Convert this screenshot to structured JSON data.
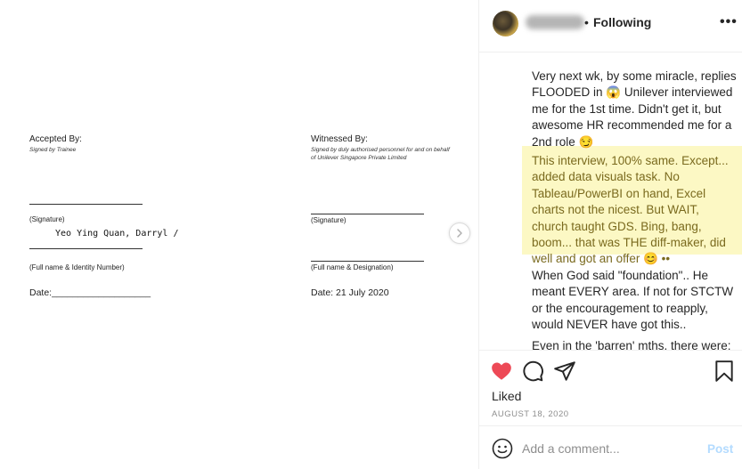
{
  "document": {
    "accepted_title": "Accepted By:",
    "accepted_sub": "Signed by Trainee",
    "witnessed_title": "Witnessed By:",
    "witnessed_sub": "Signed by duly authorised personnel for and on behalf of Unilever Singapore Private Limited",
    "signature_label": "(Signature)",
    "typed_name": "Yeo Ying Quan, Darryl /",
    "fullname_id_label": "(Full name & Identity Number)",
    "fullname_designation_label": "(Full name & Designation)",
    "date_left": "Date:___________________",
    "date_right": "Date: 21 July 2020"
  },
  "carousel": {
    "next_icon": "chevron-right-icon"
  },
  "header": {
    "separator": "•",
    "follow_label": "Following",
    "more_icon": "more-horizontal-icon",
    "more_label": "•••"
  },
  "caption": {
    "paragraphs": [
      "Very next wk, by some miracle, replies FLOODED in 😱 Unilever interviewed me for the 1st time. Didn't get it, but awesome HR recommended me for a 2nd role 😏",
      "This interview, 100% same. Except... added data visuals task. No Tableau/PowerBI on hand, Excel charts not the nicest. But WAIT, church taught GDS. Bing, bang, boom... that was THE diff-maker, did well and got an offer 😊 ••",
      "When God said \"foundation\".. He meant EVERY area. If not for STCTW or the encouragement to reapply, would NEVER have got this..",
      "Even in the 'barren' mths, there were:"
    ],
    "highlight_color": "#fcf8c4"
  },
  "actions": {
    "like_icon": "heart-filled-icon",
    "comment_icon": "comment-icon",
    "share_icon": "send-icon",
    "save_icon": "bookmark-icon",
    "like_color": "#ed4956",
    "liked_label": "Liked",
    "date": "AUGUST 18, 2020"
  },
  "comment": {
    "emoji_icon": "smiley-icon",
    "placeholder": "Add a comment...",
    "post_label": "Post",
    "post_color": "#b3dbff"
  }
}
